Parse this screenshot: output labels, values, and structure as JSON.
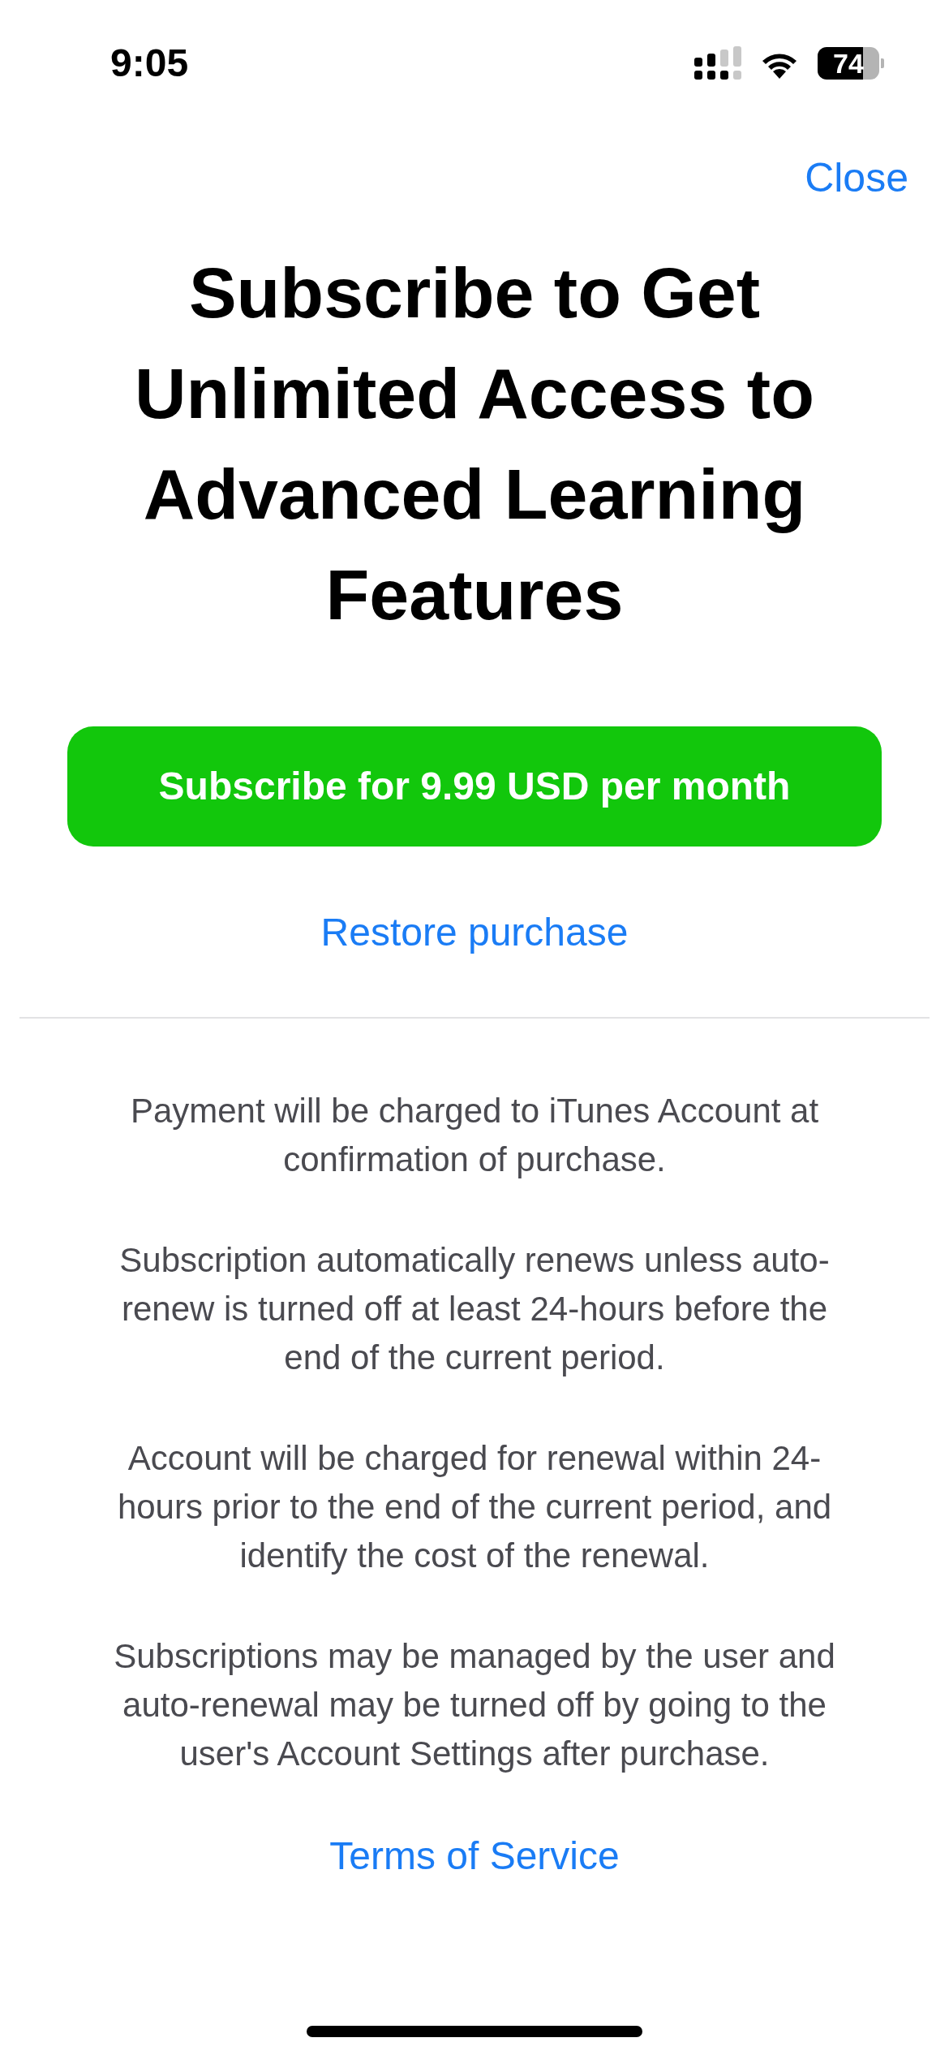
{
  "status_bar": {
    "time": "9:05",
    "battery": "74"
  },
  "close": "Close",
  "title": "Subscribe to Get Unlimited Access to Advanced Learning Features",
  "subscribe_button": "Subscribe for 9.99 USD per month",
  "restore_link": "Restore purchase",
  "terms": [
    "Payment will be charged to iTunes Account at confirmation of purchase.",
    "Subscription automatically renews unless auto-renew is turned off at least 24-hours before the end of the current period.",
    "Account will be charged for renewal within 24-hours prior to the end of the current period, and identify the cost of the renewal.",
    "Subscriptions may be managed by the user and auto-renewal may be turned off by going to the user's Account Settings after purchase."
  ],
  "terms_link": "Terms of Service"
}
